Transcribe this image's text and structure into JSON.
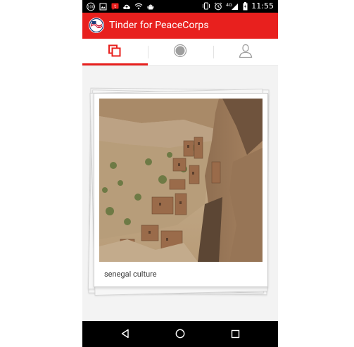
{
  "status_bar": {
    "time": "11:55",
    "network": "4G",
    "notification_count": "100",
    "icons": [
      "notification-count-icon",
      "image-icon",
      "message-icon",
      "cloud-upload-icon",
      "wifi-icon",
      "android-icon",
      "vibrate-icon",
      "alarm-icon",
      "signal-icon",
      "battery-icon"
    ]
  },
  "app_bar": {
    "title": "Tinder for PeaceCorps",
    "background_color": "#e8201e"
  },
  "tabs": [
    {
      "icon": "cards-icon",
      "selected": true
    },
    {
      "icon": "record-icon",
      "selected": false
    },
    {
      "icon": "profile-icon",
      "selected": false
    }
  ],
  "card": {
    "caption": "senegal culture",
    "image_description": "cliff dwellings"
  },
  "nav_bar": {
    "icons": [
      "back-icon",
      "home-icon",
      "recents-icon"
    ]
  }
}
